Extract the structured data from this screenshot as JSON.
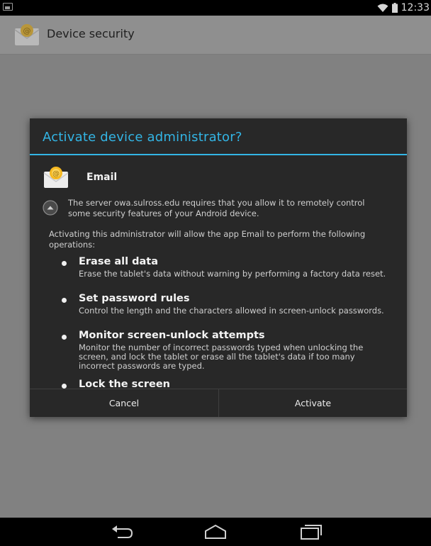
{
  "status_bar": {
    "time": "12:33",
    "icons": [
      "screenshot-icon",
      "wifi-icon",
      "battery-icon"
    ]
  },
  "action_bar": {
    "title": "Device security",
    "icon": "email-app-icon"
  },
  "dialog": {
    "title": "Activate device administrator?",
    "app_name": "Email",
    "server_message": "The server owa.sulross.edu requires that you allow it to remotely control some security features of your Android device.",
    "intro": "Activating this administrator will allow the app Email to perform the following operations:",
    "operations": [
      {
        "title": "Erase all data",
        "description": "Erase the tablet's data without warning by performing a factory data reset."
      },
      {
        "title": "Set password rules",
        "description": "Control the length and the characters allowed in screen-unlock passwords."
      },
      {
        "title": "Monitor screen-unlock attempts",
        "description": "Monitor the number of incorrect passwords typed when unlocking the screen, and lock the tablet or erase all the tablet's data if too many incorrect passwords are typed."
      },
      {
        "title": "Lock the screen",
        "description": ""
      }
    ],
    "buttons": {
      "cancel": "Cancel",
      "activate": "Activate"
    }
  },
  "nav_bar": {
    "icons": [
      "back-icon",
      "home-icon",
      "recent-apps-icon"
    ]
  },
  "colors": {
    "accent": "#33b5e5",
    "dialog_bg": "#282828",
    "dim_bg": "#818181"
  }
}
